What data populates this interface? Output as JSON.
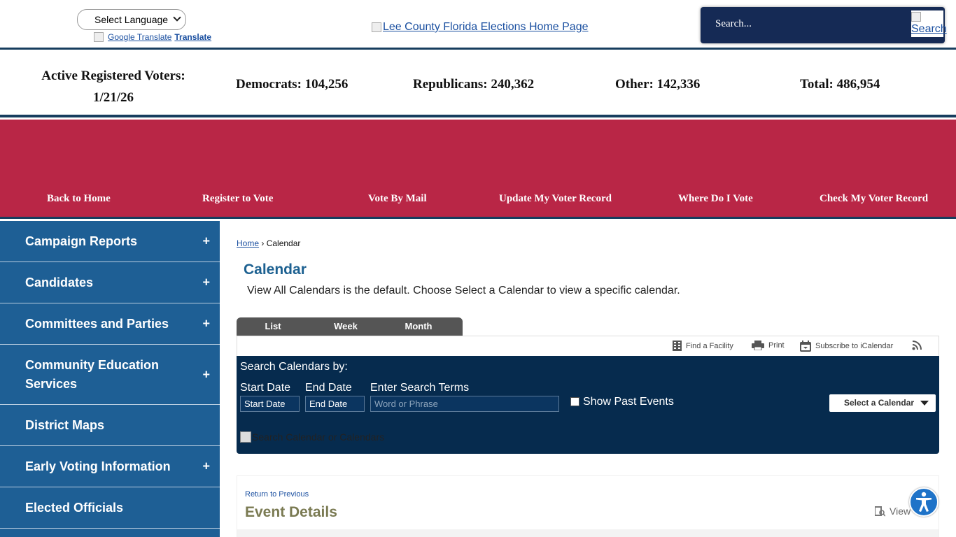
{
  "header": {
    "language_select": "Select Language",
    "google_translate_img_alt": "Google Translate",
    "translate_link": "Translate",
    "logo_alt": "Lee County Florida Elections Home Page",
    "search_placeholder": "Search...",
    "search_button_alt": "Search"
  },
  "stats": {
    "active_label": "Active Registered Voters:",
    "active_date": "1/21/26",
    "democrats": "Democrats: 104,256",
    "republicans": "Republicans: 240,362",
    "other": "Other: 142,336",
    "total": "Total: 486,954"
  },
  "nav": [
    {
      "label": "Back to Home"
    },
    {
      "label": "Register to Vote"
    },
    {
      "label": "Vote By Mail"
    },
    {
      "label": "Update My Voter Record"
    },
    {
      "label": "Where Do I Vote"
    },
    {
      "label": "Check My Voter Record"
    }
  ],
  "sidebar": [
    {
      "label": "Campaign Reports",
      "expand": "+"
    },
    {
      "label": "Candidates",
      "expand": "+"
    },
    {
      "label": "Committees and Parties",
      "expand": "+"
    },
    {
      "label": "Community Education Services",
      "expand": "+"
    },
    {
      "label": "District Maps",
      "expand": ""
    },
    {
      "label": "Early Voting Information",
      "expand": "+"
    },
    {
      "label": "Elected Officials",
      "expand": ""
    }
  ],
  "breadcrumb": {
    "home": "Home",
    "sep": "›",
    "current": "Calendar"
  },
  "page": {
    "title": "Calendar",
    "intro": "View All Calendars is the default. Choose Select a Calendar to view a specific calendar."
  },
  "tabs": [
    {
      "label": "List"
    },
    {
      "label": "Week"
    },
    {
      "label": "Month"
    }
  ],
  "toolbar": {
    "find_facility": "Find a Facility",
    "print": "Print",
    "subscribe": "Subscribe to iCalendar"
  },
  "search": {
    "title": "Search Calendars by:",
    "start_label": "Start Date",
    "start_value": "Start Date",
    "end_label": "End Date",
    "end_value": "End Date",
    "terms_label": "Enter Search Terms",
    "terms_placeholder": "Word or Phrase",
    "show_past": "Show Past Events",
    "select_calendar": "Select a Calendar",
    "search_button_alt": "Search Calendar or Calendars"
  },
  "details": {
    "return": "Return to Previous",
    "title": "Event Details",
    "view": "View"
  },
  "colors": {
    "navy": "#173d5e",
    "band_red": "#b92646",
    "sidebar_blue": "#1e5f95",
    "panel_navy": "#062b4e",
    "title_blue": "#1d6191"
  }
}
